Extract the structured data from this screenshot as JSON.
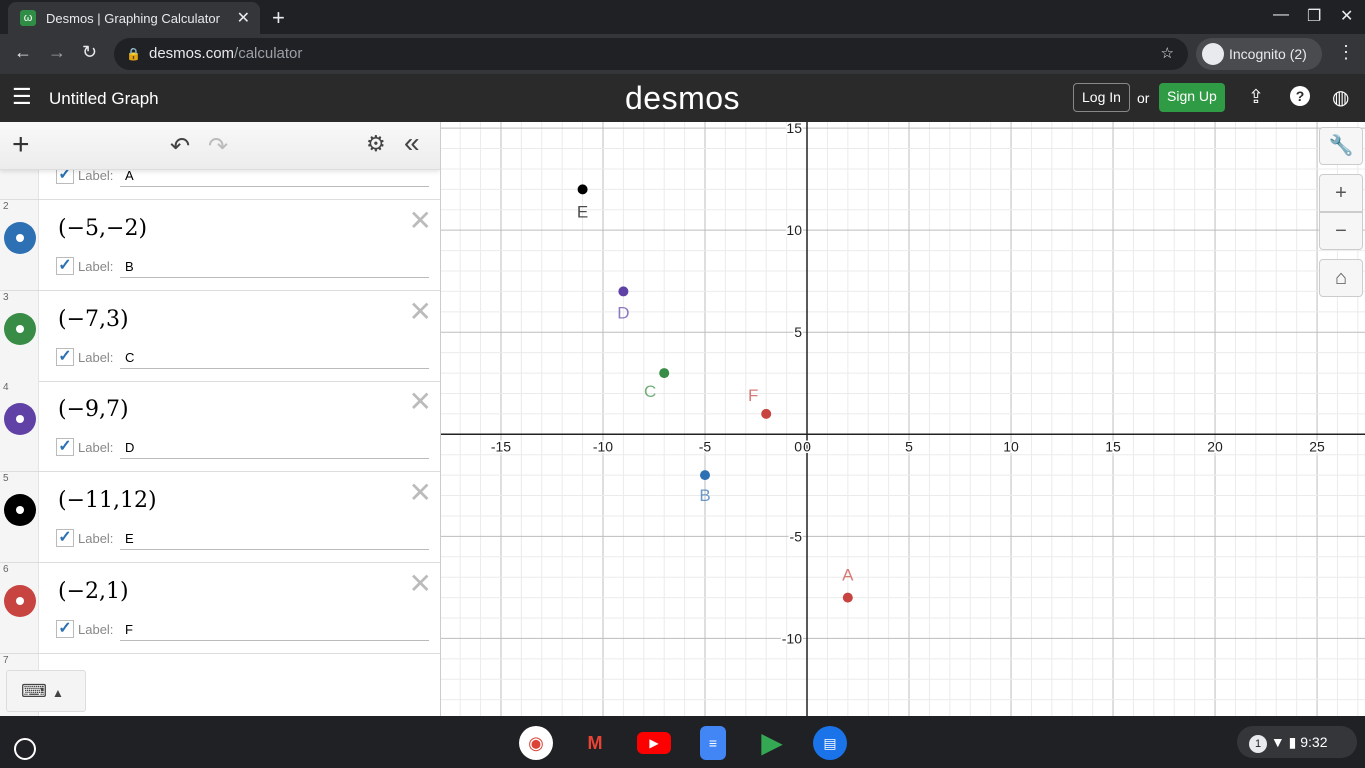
{
  "browser": {
    "tab_title": "Desmos | Graphing Calculator",
    "url_host": "desmos.com",
    "url_path": "/calculator",
    "profile": "Incognito (2)"
  },
  "header": {
    "title": "Untitled Graph",
    "logo": "desmos",
    "login": "Log In",
    "or": "or",
    "signup": "Sign Up"
  },
  "expressions": [
    {
      "num": "2",
      "latex": "(−5,−2)",
      "label_text": "Label:",
      "label": "B",
      "color": "#2d70b3"
    },
    {
      "num": "3",
      "latex": "(−7,3)",
      "label_text": "Label:",
      "label": "C",
      "color": "#388c46"
    },
    {
      "num": "4",
      "latex": "(−9,7)",
      "label_text": "Label:",
      "label": "D",
      "color": "#6042a6"
    },
    {
      "num": "5",
      "latex": "(−11,12)",
      "label_text": "Label:",
      "label": "E",
      "color": "#000000"
    },
    {
      "num": "6",
      "latex": "(−2,1)",
      "label_text": "Label:",
      "label": "F",
      "color": "#c74440"
    }
  ],
  "partial_expression": {
    "label_text": "Label:",
    "label": "A"
  },
  "next_expression_num": "7",
  "chart_data": {
    "type": "scatter",
    "xlim": [
      -17.94,
      27.35
    ],
    "ylim": [
      -13.8,
      15.3
    ],
    "grid": true,
    "x_ticks": [
      -15,
      -10,
      -5,
      0,
      5,
      10,
      15,
      20,
      25
    ],
    "y_ticks": [
      -10,
      -5,
      5,
      10,
      15
    ],
    "points": [
      {
        "label": "A",
        "x": 2,
        "y": -8,
        "color": "#c74440"
      },
      {
        "label": "B",
        "x": -5,
        "y": -2,
        "color": "#2d70b3"
      },
      {
        "label": "C",
        "x": -7,
        "y": 3,
        "color": "#388c46"
      },
      {
        "label": "D",
        "x": -9,
        "y": 7,
        "color": "#6042a6"
      },
      {
        "label": "E",
        "x": -11,
        "y": 12,
        "color": "#000000"
      },
      {
        "label": "F",
        "x": -2,
        "y": 1,
        "color": "#c74440"
      }
    ]
  },
  "shelf": {
    "time": "9:32",
    "notif": "1"
  }
}
